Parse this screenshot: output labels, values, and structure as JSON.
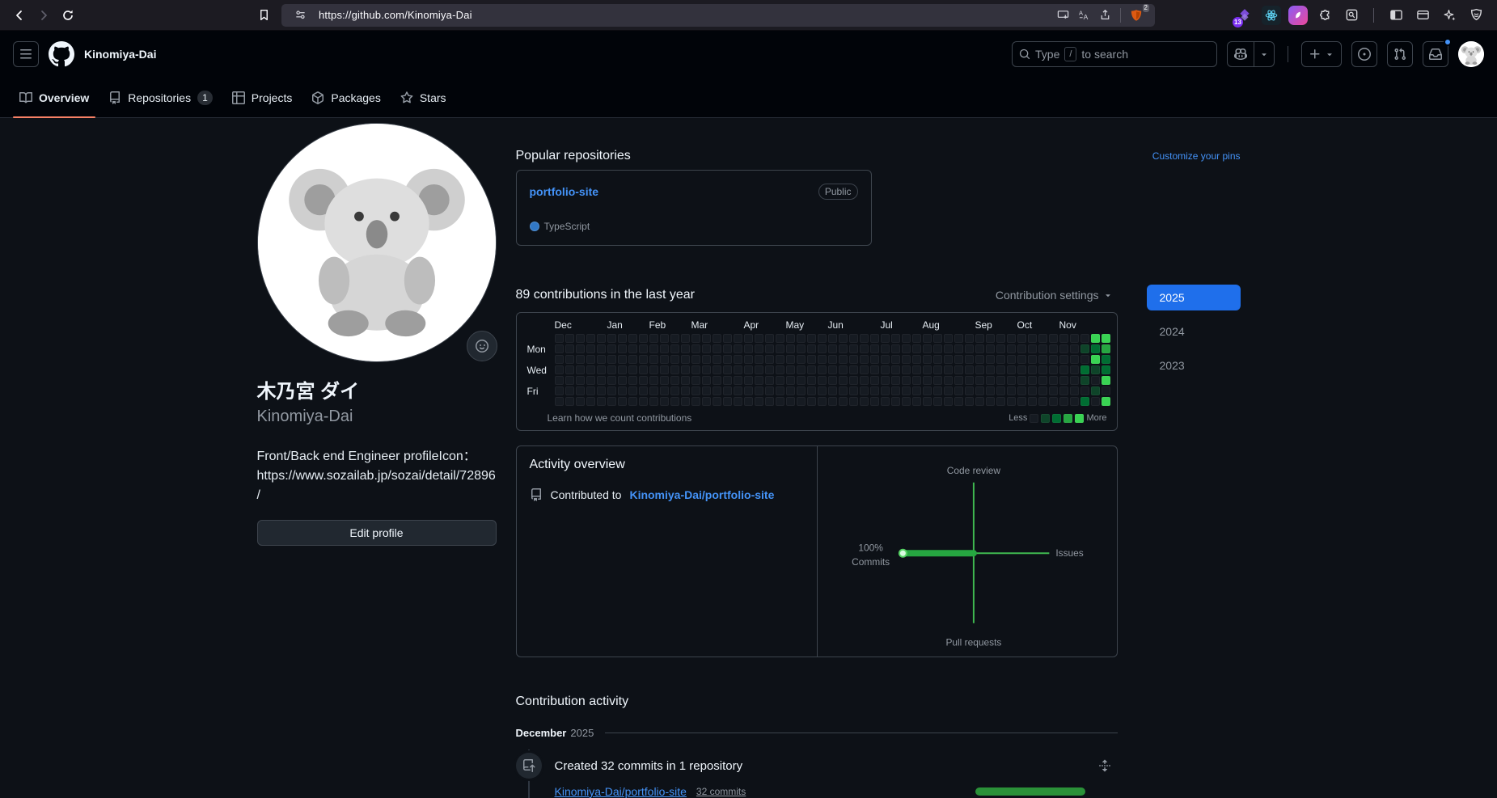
{
  "browser": {
    "url": "https://github.com/Kinomiya-Dai",
    "adblock_badge": "2",
    "extension_badge": "13"
  },
  "header": {
    "title": "Kinomiya-Dai",
    "search": {
      "prefix": "Type",
      "key": "/",
      "suffix": "to search"
    }
  },
  "nav": {
    "tabs": [
      {
        "label": "Overview"
      },
      {
        "label": "Repositories",
        "count": "1"
      },
      {
        "label": "Projects"
      },
      {
        "label": "Packages"
      },
      {
        "label": "Stars"
      }
    ]
  },
  "profile": {
    "display_name": "木乃宮 ダイ",
    "username": "Kinomiya-Dai",
    "bio": "Front/Back end Engineer profileIcon：https://www.sozailab.jp/sozai/detail/72896/",
    "edit_button": "Edit profile"
  },
  "popular": {
    "heading": "Popular repositories",
    "customize_link": "Customize your pins",
    "repo": {
      "name": "portfolio-site",
      "visibility": "Public",
      "language": "TypeScript",
      "language_color": "#3178c6"
    }
  },
  "contributions": {
    "heading": "89 contributions in the last year",
    "settings_label": "Contribution settings",
    "weeks": 53,
    "day_labels": [
      {
        "label": "Mon",
        "row": 1
      },
      {
        "label": "Wed",
        "row": 3
      },
      {
        "label": "Fri",
        "row": 5
      }
    ],
    "months": [
      {
        "label": "Dec",
        "week": 0
      },
      {
        "label": "Jan",
        "week": 5
      },
      {
        "label": "Feb",
        "week": 9
      },
      {
        "label": "Mar",
        "week": 13
      },
      {
        "label": "Apr",
        "week": 18
      },
      {
        "label": "May",
        "week": 22
      },
      {
        "label": "Jun",
        "week": 26
      },
      {
        "label": "Jul",
        "week": 31
      },
      {
        "label": "Aug",
        "week": 35
      },
      {
        "label": "Sep",
        "week": 40
      },
      {
        "label": "Oct",
        "week": 44
      },
      {
        "label": "Nov",
        "week": 48
      }
    ],
    "level_colors": [
      "#161b22",
      "#0e4429",
      "#006d32",
      "#26a641",
      "#39d353"
    ],
    "cells": [
      {
        "week": 50,
        "day": 1,
        "level": 1
      },
      {
        "week": 50,
        "day": 3,
        "level": 2
      },
      {
        "week": 50,
        "day": 4,
        "level": 1
      },
      {
        "week": 50,
        "day": 6,
        "level": 2
      },
      {
        "week": 51,
        "day": 0,
        "level": 4
      },
      {
        "week": 51,
        "day": 1,
        "level": 2
      },
      {
        "week": 51,
        "day": 2,
        "level": 4
      },
      {
        "week": 51,
        "day": 3,
        "level": 1
      },
      {
        "week": 51,
        "day": 5,
        "level": 1
      },
      {
        "week": 52,
        "day": 0,
        "level": 4
      },
      {
        "week": 52,
        "day": 1,
        "level": 3
      },
      {
        "week": 52,
        "day": 2,
        "level": 2
      },
      {
        "week": 52,
        "day": 3,
        "level": 2
      },
      {
        "week": 52,
        "day": 4,
        "level": 4
      },
      {
        "week": 52,
        "day": 6,
        "level": 4
      }
    ],
    "learn_link": "Learn how we count contributions",
    "less": "Less",
    "more": "More",
    "years": [
      {
        "label": "2025",
        "selected": true
      },
      {
        "label": "2024",
        "selected": false
      },
      {
        "label": "2023",
        "selected": false
      }
    ]
  },
  "activity": {
    "heading": "Activity overview",
    "contributed_prefix": "Contributed to",
    "contributed_repo": "Kinomiya-Dai/portfolio-site",
    "compass": {
      "top": "Code review",
      "right": "Issues",
      "bottom": "Pull requests",
      "percent": "100%",
      "percent_label": "Commits",
      "axis_color": "#3fb950",
      "bar_color": "#26a641"
    }
  },
  "timeline": {
    "heading": "Contribution activity",
    "month": "December",
    "year": "2025",
    "event_title": "Created 32 commits in 1 repository",
    "repo_link": "Kinomiya-Dai/portfolio-site",
    "commit_count": "32 commits",
    "bar_color": "#2a9138"
  }
}
